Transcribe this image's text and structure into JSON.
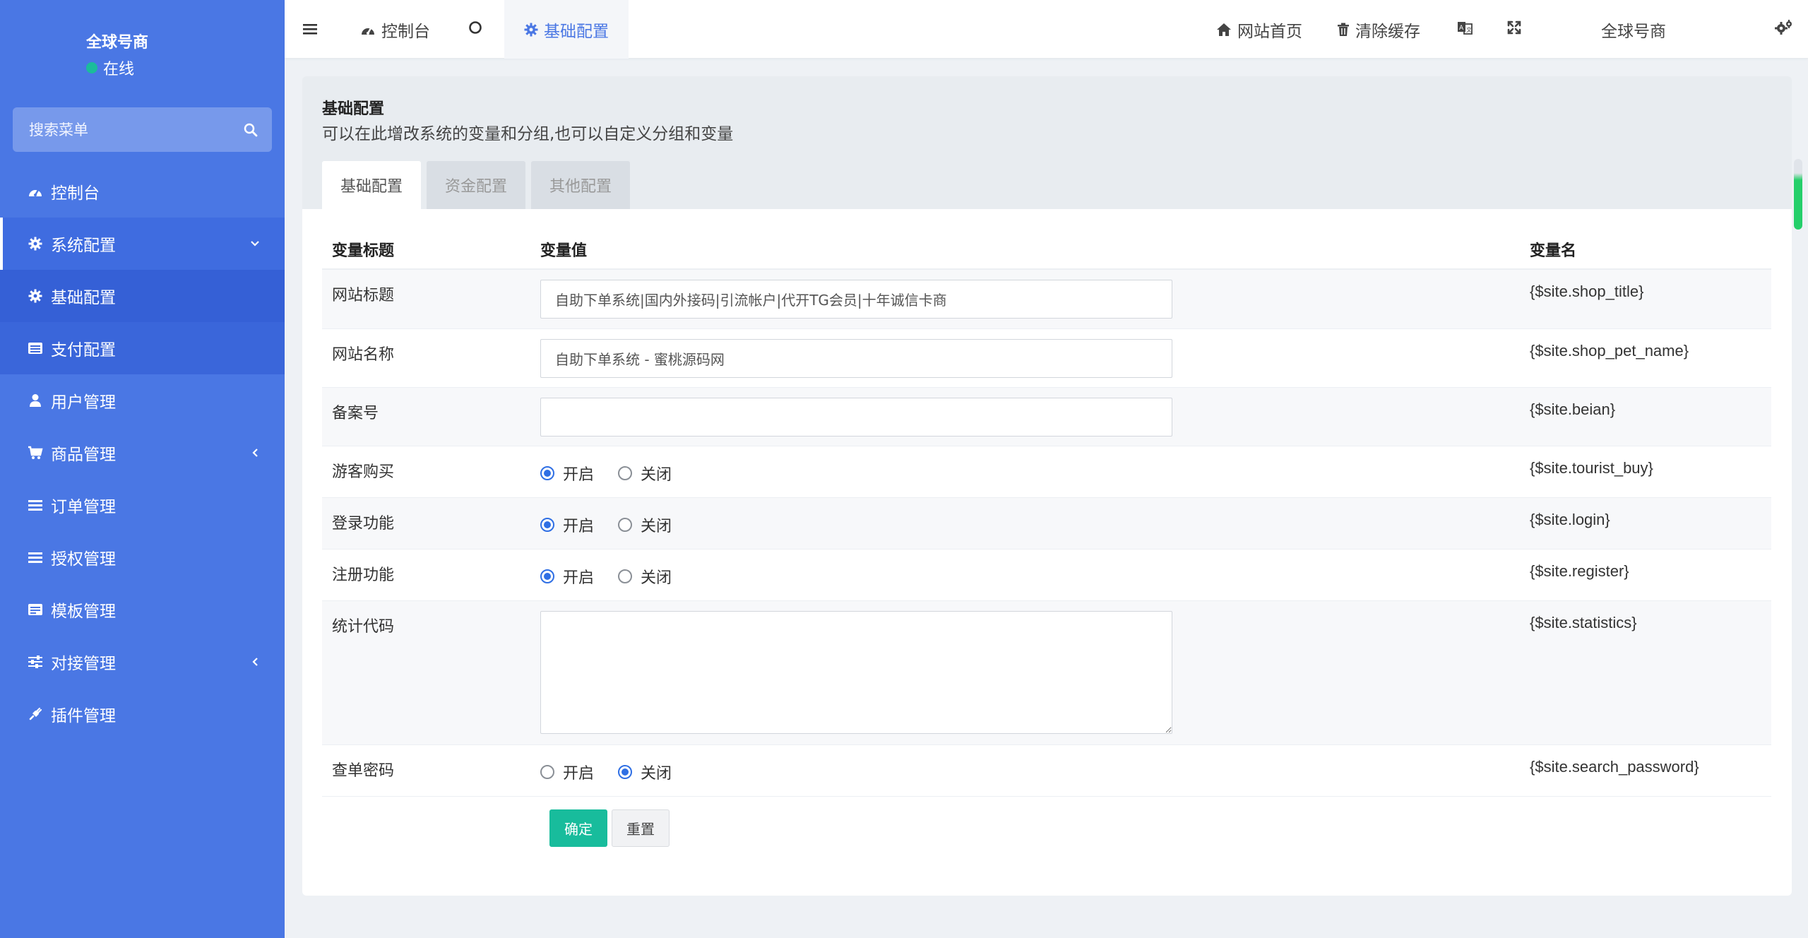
{
  "sidebar": {
    "user_name": "全球号商",
    "user_status": "在线",
    "search_placeholder": "搜索菜单",
    "items": [
      {
        "label": "控制台",
        "icon": "dashboard-icon"
      },
      {
        "label": "系统配置",
        "icon": "gear-icon",
        "expanded": true
      },
      {
        "label": "基础配置",
        "icon": "gear-icon",
        "active": true
      },
      {
        "label": "支付配置",
        "icon": "list-icon"
      },
      {
        "label": "用户管理",
        "icon": "user-icon"
      },
      {
        "label": "商品管理",
        "icon": "cart-icon"
      },
      {
        "label": "订单管理",
        "icon": "bars-icon"
      },
      {
        "label": "授权管理",
        "icon": "bars-icon"
      },
      {
        "label": "模板管理",
        "icon": "template-icon"
      },
      {
        "label": "对接管理",
        "icon": "sliders-icon"
      },
      {
        "label": "插件管理",
        "icon": "plug-icon"
      }
    ]
  },
  "topbar": {
    "tab_dashboard": "控制台",
    "tab_current": "基础配置",
    "site_home": "网站首页",
    "clear_cache": "清除缓存",
    "user_name": "全球号商"
  },
  "page": {
    "title": "基础配置",
    "description": "可以在此增改系统的变量和分组,也可以自定义分组和变量",
    "tabs": [
      "基础配置",
      "资金配置",
      "其他配置"
    ]
  },
  "table": {
    "headers": [
      "变量标题",
      "变量值",
      "变量名"
    ],
    "rows": [
      {
        "title": "网站标题",
        "type": "text",
        "value": "自助下单系统|国内外接码|引流帐户|代开TG会员|十年诚信卡商",
        "var": "{$site.shop_title}"
      },
      {
        "title": "网站名称",
        "type": "text",
        "value": "自助下单系统 - 蜜桃源码网",
        "var": "{$site.shop_pet_name}"
      },
      {
        "title": "备案号",
        "type": "text",
        "value": "",
        "var": "{$site.beian}"
      },
      {
        "title": "游客购买",
        "type": "radio",
        "selected": "开启",
        "var": "{$site.tourist_buy}"
      },
      {
        "title": "登录功能",
        "type": "radio",
        "selected": "开启",
        "var": "{$site.login}"
      },
      {
        "title": "注册功能",
        "type": "radio",
        "selected": "开启",
        "var": "{$site.register}"
      },
      {
        "title": "统计代码",
        "type": "textarea",
        "value": "",
        "var": "{$site.statistics}"
      },
      {
        "title": "查单密码",
        "type": "radio",
        "selected": "关闭",
        "var": "{$site.search_password}"
      }
    ],
    "radio_on": "开启",
    "radio_off": "关闭"
  },
  "buttons": {
    "confirm": "确定",
    "reset": "重置"
  },
  "colors": {
    "sidebar": "#4a77e4",
    "accent": "#4a77e4",
    "primary_button": "#18bc9c",
    "online_dot": "#1bbc9b"
  }
}
